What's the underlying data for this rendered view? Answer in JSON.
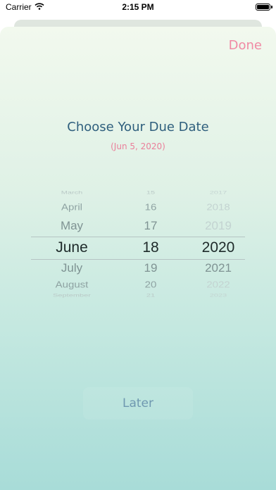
{
  "status_bar": {
    "carrier": "Carrier",
    "time": "2:15 PM"
  },
  "header": {
    "done_label": "Done"
  },
  "main": {
    "title": "Choose Your Due Date",
    "subtitle": "(Jun 5, 2020)"
  },
  "picker": {
    "months": [
      "March",
      "April",
      "May",
      "June",
      "July",
      "August",
      "September"
    ],
    "days": [
      "15",
      "16",
      "17",
      "18",
      "19",
      "20",
      "21"
    ],
    "years": [
      "2017",
      "2018",
      "2019",
      "2020",
      "2021",
      "2022",
      "2023"
    ],
    "selected": {
      "month": "June",
      "day": "18",
      "year": "2020"
    }
  },
  "footer": {
    "later_label": "Later"
  }
}
